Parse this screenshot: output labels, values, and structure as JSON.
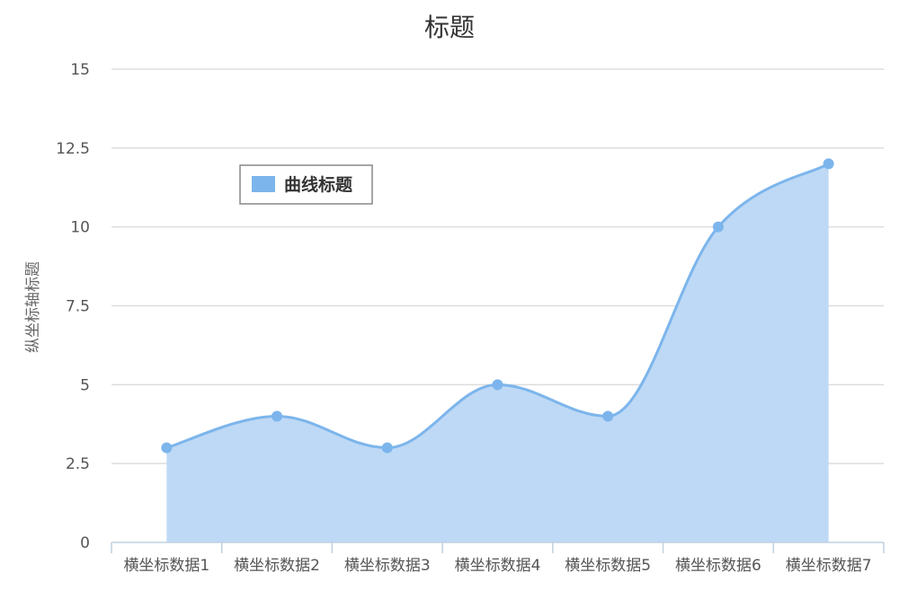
{
  "chart_data": {
    "type": "area",
    "title": "标题",
    "ylabel": "纵坐标轴标题",
    "xlabel": "",
    "categories": [
      "横坐标数据1",
      "横坐标数据2",
      "横坐标数据3",
      "横坐标数据4",
      "横坐标数据5",
      "横坐标数据6",
      "横坐标数据7"
    ],
    "series": [
      {
        "name": "曲线标题",
        "values": [
          3,
          4,
          3,
          5,
          4,
          10,
          12
        ]
      }
    ],
    "ylim": [
      0,
      15
    ],
    "yticks": [
      "0",
      "2.5",
      "5",
      "7.5",
      "10",
      "12.5",
      "15"
    ],
    "ytick_values": [
      0,
      2.5,
      5,
      7.5,
      10,
      12.5,
      15
    ],
    "grid": true,
    "legend_position": "inside-top-left",
    "colors": {
      "line": "#7cb5ec",
      "fill": "#bed9f5",
      "grid": "#dddddd",
      "axis": "#c0d0e0"
    }
  }
}
